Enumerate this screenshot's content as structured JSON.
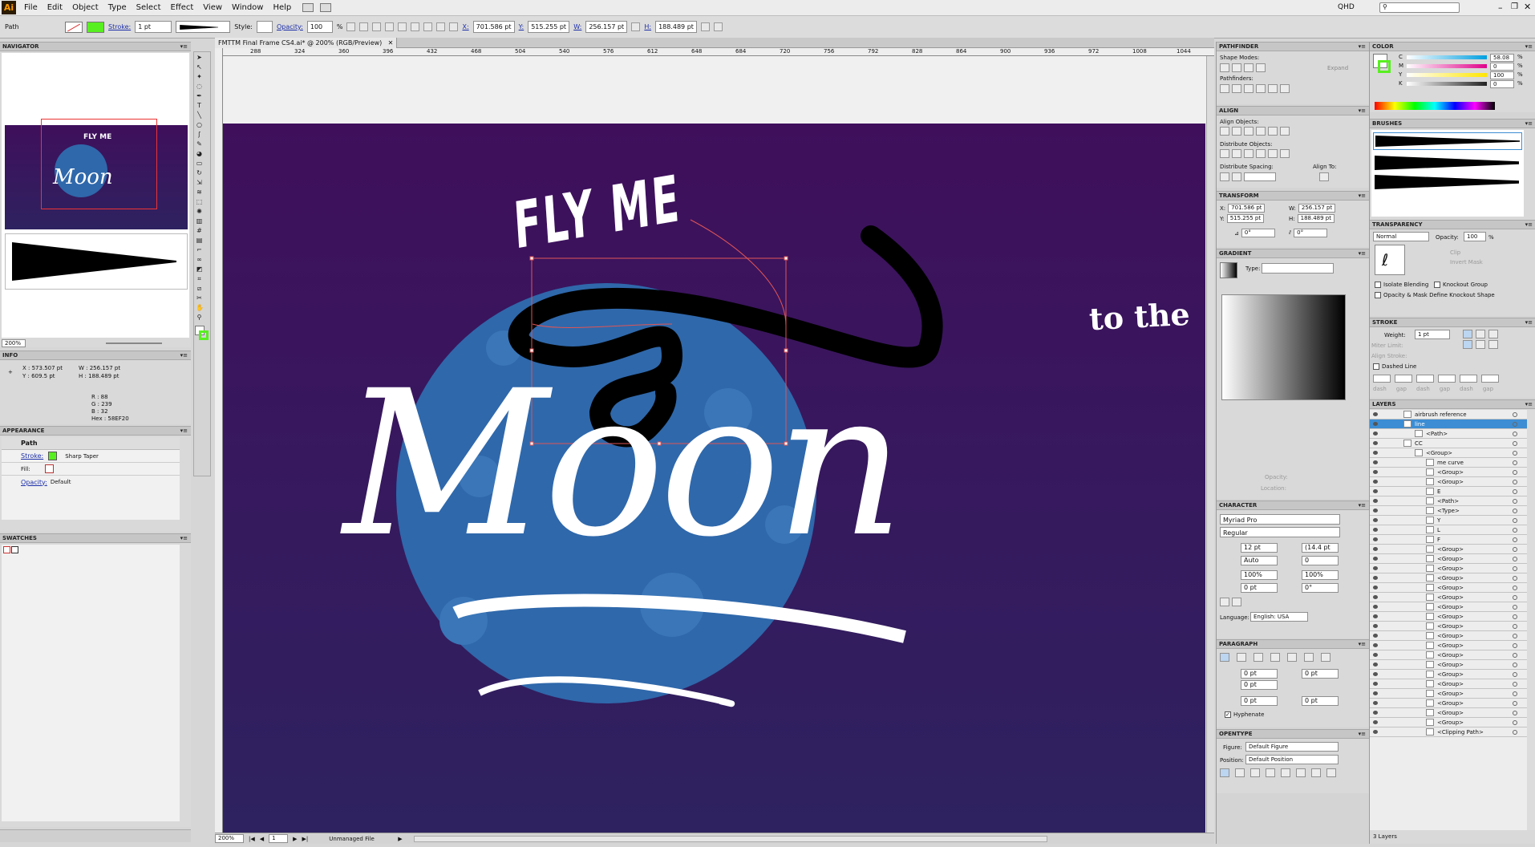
{
  "app": {
    "logo": "Ai"
  },
  "menu": [
    "File",
    "Edit",
    "Object",
    "Type",
    "Select",
    "Effect",
    "View",
    "Window",
    "Help"
  ],
  "workspace": "QHD",
  "control": {
    "object_type": "Path",
    "stroke_label": "Stroke:",
    "stroke_weight": "1 pt",
    "style_label": "Style:",
    "opacity_label": "Opacity:",
    "opacity_value": "100",
    "opacity_unit": "%",
    "x_label": "X:",
    "x": "701.586 pt",
    "y_label": "Y:",
    "y": "515.255 pt",
    "w_label": "W:",
    "w": "256.157 pt",
    "h_label": "H:",
    "h": "188.489 pt"
  },
  "document": {
    "tab": "FMTTM Final Frame CS4.ai* @ 200% (RGB/Preview)",
    "ruler_ticks": [
      "288",
      "324",
      "360",
      "396",
      "432",
      "468",
      "504",
      "540",
      "576",
      "612",
      "648",
      "684",
      "720",
      "756",
      "792",
      "828",
      "864",
      "900",
      "936",
      "972",
      "1008",
      "1044"
    ],
    "zoom": "200%",
    "page": "1",
    "status": "Unmanaged File"
  },
  "artwork": {
    "headline": "FLY ME",
    "side_text": "to the",
    "title": "Moon",
    "bg_top": "#3f0f5c",
    "bg_bottom": "#2e2260",
    "moon_color": "#2f68ab"
  },
  "navigator": {
    "title": "NAVIGATOR",
    "zoom": "200%"
  },
  "info": {
    "title": "INFO",
    "x": "X : 573.507 pt",
    "y": "Y : 609.5 pt",
    "w": "W : 256.157 pt",
    "h": "H : 188.489 pt",
    "r": "R : 88",
    "g": "G : 239",
    "b": "B : 32",
    "hex": "Hex : 58EF20"
  },
  "appearance": {
    "title": "APPEARANCE",
    "object": "Path",
    "stroke_label": "Stroke:",
    "stroke_value": "Sharp Taper",
    "fill_label": "Fill:",
    "opacity_label": "Opacity:",
    "opacity_value": "Default"
  },
  "swatches": {
    "title": "SWATCHES"
  },
  "pathfinder": {
    "title": "PATHFINDER",
    "shape_modes": "Shape Modes:",
    "expand": "Expand",
    "pathfinders": "Pathfinders:"
  },
  "align": {
    "title": "ALIGN",
    "align_objects": "Align Objects:",
    "distribute_objects": "Distribute Objects:",
    "distribute_spacing": "Distribute Spacing:",
    "align_to": "Align To:"
  },
  "transform": {
    "title": "TRANSFORM",
    "x_label": "X:",
    "x": "701.586 pt",
    "y_label": "Y:",
    "y": "515.255 pt",
    "w_label": "W:",
    "w": "256.157 pt",
    "h_label": "H:",
    "h": "188.489 pt",
    "rotate": "0°",
    "shear": "0°"
  },
  "gradient": {
    "title": "GRADIENT",
    "type_label": "Type:",
    "opacity_label": "Opacity:",
    "location_label": "Location:",
    "pct": "%"
  },
  "character": {
    "title": "CHARACTER",
    "font": "Myriad Pro",
    "style": "Regular",
    "size": "12 pt",
    "leading": "(14.4 pt",
    "kerning": "Auto",
    "tracking": "0",
    "vscale": "100%",
    "hscale": "100%",
    "baseline": "0 pt",
    "rotation": "0°",
    "language_label": "Language:",
    "language": "English: USA"
  },
  "paragraph": {
    "title": "PARAGRAPH",
    "left_indent": "0 pt",
    "right_indent": "0 pt",
    "first_indent": "0 pt",
    "space_before": "0 pt",
    "space_after": "0 pt",
    "hyphenate": "Hyphenate"
  },
  "opentype": {
    "title": "OPENTYPE",
    "figure_label": "Figure:",
    "figure": "Default Figure",
    "position_label": "Position:",
    "position": "Default Position"
  },
  "color": {
    "title": "COLOR",
    "channels": [
      {
        "label": "C",
        "value": "58.08",
        "unit": "%",
        "color": "#00a0e0"
      },
      {
        "label": "M",
        "value": "0",
        "unit": "%",
        "color": "#e0008a"
      },
      {
        "label": "Y",
        "value": "100",
        "unit": "%",
        "color": "#ffe600"
      },
      {
        "label": "K",
        "value": "0",
        "unit": "%",
        "color": "#222222"
      }
    ]
  },
  "brushes": {
    "title": "BRUSHES"
  },
  "transparency": {
    "title": "TRANSPARENCY",
    "mode": "Normal",
    "opacity_label": "Opacity:",
    "opacity": "100",
    "unit": "%",
    "clip": "Clip",
    "invert_mask": "Invert Mask",
    "isolate": "Isolate Blending",
    "knockout": "Knockout Group",
    "opacity_mask": "Opacity & Mask Define Knockout Shape"
  },
  "stroke": {
    "title": "STROKE",
    "weight_label": "Weight:",
    "weight": "1 pt",
    "miter_label": "Miter Limit:",
    "align_label": "Align Stroke:",
    "dashed": "Dashed Line",
    "dash_labels": [
      "dash",
      "gap",
      "dash",
      "gap",
      "dash",
      "gap"
    ]
  },
  "layers": {
    "title": "LAYERS",
    "items": [
      {
        "name": "airbrush reference",
        "indent": 0,
        "selected": false
      },
      {
        "name": "line",
        "indent": 0,
        "selected": true
      },
      {
        "name": "<Path>",
        "indent": 1,
        "selected": false
      },
      {
        "name": "CC",
        "indent": 0,
        "selected": false
      },
      {
        "name": "<Group>",
        "indent": 1,
        "selected": false
      },
      {
        "name": "me curve",
        "indent": 2,
        "selected": false
      },
      {
        "name": "<Group>",
        "indent": 2,
        "selected": false
      },
      {
        "name": "<Group>",
        "indent": 2,
        "selected": false
      },
      {
        "name": "E",
        "indent": 2,
        "selected": false
      },
      {
        "name": "<Path>",
        "indent": 2,
        "selected": false
      },
      {
        "name": "<Type>",
        "indent": 2,
        "selected": false
      },
      {
        "name": "Y",
        "indent": 2,
        "selected": false
      },
      {
        "name": "L",
        "indent": 2,
        "selected": false
      },
      {
        "name": "F",
        "indent": 2,
        "selected": false
      },
      {
        "name": "<Group>",
        "indent": 2,
        "selected": false
      },
      {
        "name": "<Group>",
        "indent": 2,
        "selected": false
      },
      {
        "name": "<Group>",
        "indent": 2,
        "selected": false
      },
      {
        "name": "<Group>",
        "indent": 2,
        "selected": false
      },
      {
        "name": "<Group>",
        "indent": 2,
        "selected": false
      },
      {
        "name": "<Group>",
        "indent": 2,
        "selected": false
      },
      {
        "name": "<Group>",
        "indent": 2,
        "selected": false
      },
      {
        "name": "<Group>",
        "indent": 2,
        "selected": false
      },
      {
        "name": "<Group>",
        "indent": 2,
        "selected": false
      },
      {
        "name": "<Group>",
        "indent": 2,
        "selected": false
      },
      {
        "name": "<Group>",
        "indent": 2,
        "selected": false
      },
      {
        "name": "<Group>",
        "indent": 2,
        "selected": false
      },
      {
        "name": "<Group>",
        "indent": 2,
        "selected": false
      },
      {
        "name": "<Group>",
        "indent": 2,
        "selected": false
      },
      {
        "name": "<Group>",
        "indent": 2,
        "selected": false
      },
      {
        "name": "<Group>",
        "indent": 2,
        "selected": false
      },
      {
        "name": "<Group>",
        "indent": 2,
        "selected": false
      },
      {
        "name": "<Group>",
        "indent": 2,
        "selected": false
      },
      {
        "name": "<Group>",
        "indent": 2,
        "selected": false
      },
      {
        "name": "<Clipping Path>",
        "indent": 2,
        "selected": false
      }
    ],
    "footer": "3 Layers"
  }
}
